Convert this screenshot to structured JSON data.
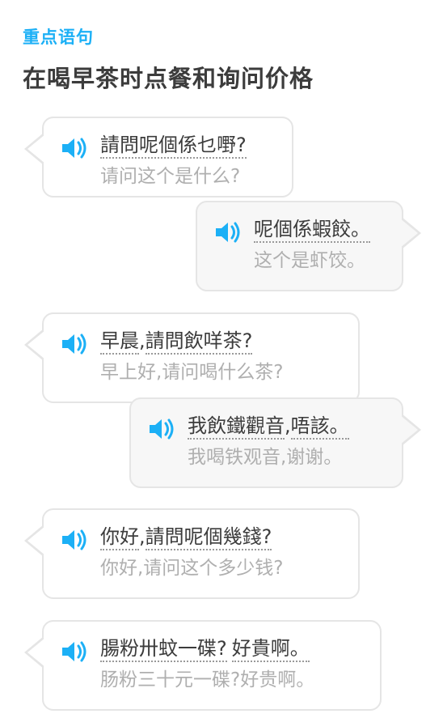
{
  "header": {
    "section_label": "重点语句",
    "title": "在喝早茶时点餐和询问价格"
  },
  "colors": {
    "accent": "#1cb0f6",
    "text": "#3c3c3c",
    "subtext": "#afafaf",
    "border": "#e5e5e5"
  },
  "dialogs": [
    {
      "side": "left",
      "cantonese": "請問呢個係乜嘢?",
      "mandarin": "请问这个是什么?",
      "icon": "speaker-icon"
    },
    {
      "side": "right",
      "cantonese": "呢個係蝦餃。",
      "mandarin": "这个是虾饺。",
      "icon": "speaker-icon"
    },
    {
      "side": "left",
      "cantonese_a": "早晨",
      "cantonese_sep": ",",
      "cantonese_b": "請問飲咩茶?",
      "mandarin": "早上好,请问喝什么茶?",
      "icon": "speaker-icon"
    },
    {
      "side": "right",
      "cantonese_a": "我飲鐵觀音",
      "cantonese_sep": ",",
      "cantonese_b": "唔該。",
      "mandarin": "我喝铁观音,谢谢。",
      "icon": "speaker-icon"
    },
    {
      "side": "left",
      "cantonese_a": "你好",
      "cantonese_sep": ",",
      "cantonese_b": "請問呢個幾錢?",
      "mandarin": "你好,请问这个多少钱?",
      "icon": "speaker-icon"
    },
    {
      "side": "left",
      "cantonese_a": "腸粉卅蚊一碟?",
      "cantonese_b": "好貴啊。",
      "mandarin": "肠粉三十元一碟?好贵啊。",
      "icon": "speaker-icon"
    }
  ]
}
